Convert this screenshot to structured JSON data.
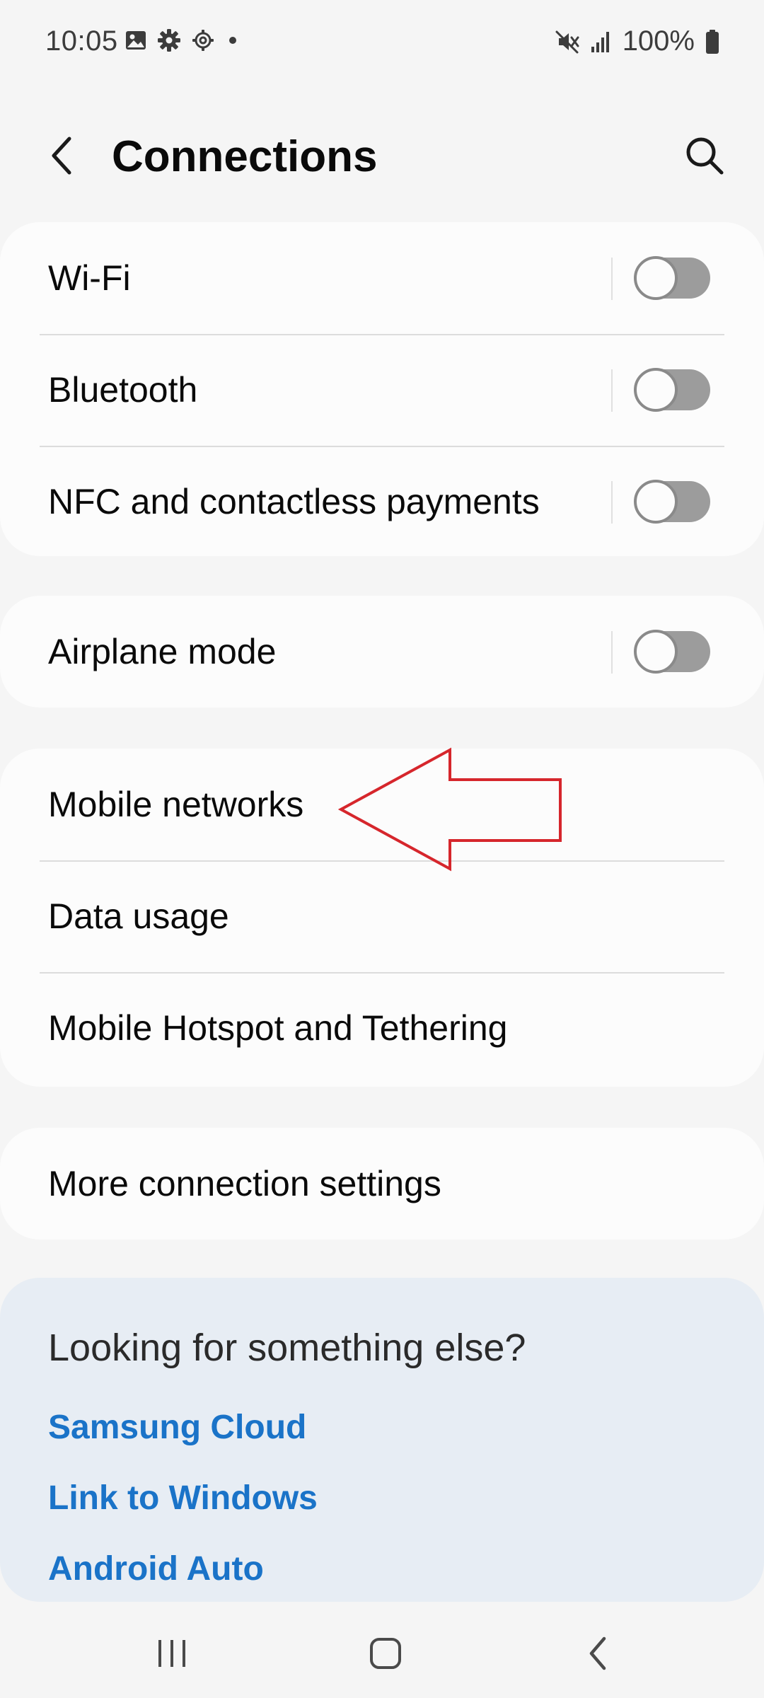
{
  "status_bar": {
    "time": "10:05",
    "left_icons": [
      "gallery-icon",
      "gear-icon",
      "gear-outline-icon",
      "dot-icon"
    ],
    "right_icons": [
      "mute-icon",
      "signal-icon",
      "battery-icon"
    ],
    "battery_percent": "100%"
  },
  "header": {
    "title": "Connections",
    "back_icon": "back-arrow-icon",
    "search_icon": "search-icon"
  },
  "groups": [
    {
      "items": [
        {
          "label": "Wi-Fi",
          "toggle": false
        },
        {
          "label": "Bluetooth",
          "toggle": false
        },
        {
          "label": "NFC and contactless payments",
          "toggle": false
        }
      ]
    },
    {
      "items": [
        {
          "label": "Airplane mode",
          "toggle": false
        }
      ]
    },
    {
      "items": [
        {
          "label": "Mobile networks"
        },
        {
          "label": "Data usage"
        },
        {
          "label": "Mobile Hotspot and Tethering"
        }
      ]
    },
    {
      "items": [
        {
          "label": "More connection settings"
        }
      ]
    }
  ],
  "suggestions": {
    "title": "Looking for something else?",
    "links": [
      "Samsung Cloud",
      "Link to Windows",
      "Android Auto"
    ]
  },
  "nav_bar": {
    "icons": [
      "recents-icon",
      "home-icon",
      "back-icon"
    ]
  },
  "colors": {
    "background": "#f5f5f5",
    "card": "#fcfcfc",
    "link": "#1a73c8",
    "annotation": "#d6262c",
    "help_card": "#e7edf4"
  }
}
